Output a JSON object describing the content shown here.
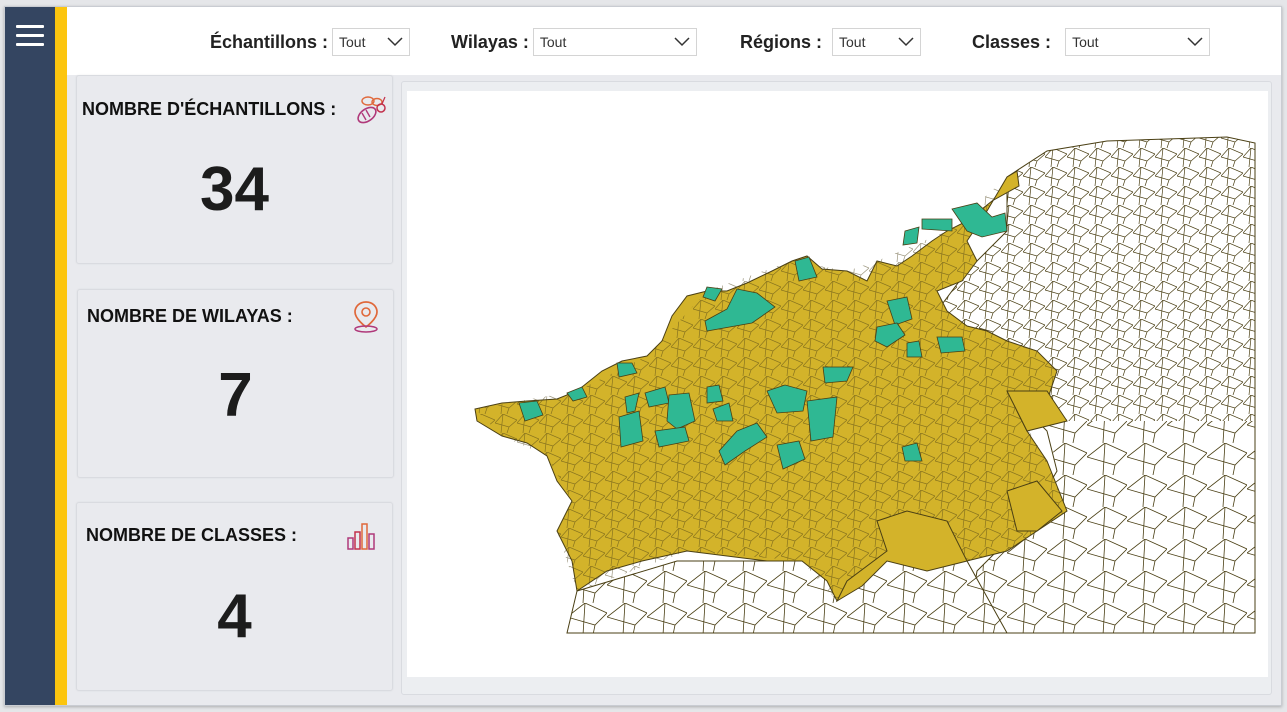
{
  "filters": [
    {
      "label": "Échantillons :",
      "value": "Tout"
    },
    {
      "label": "Wilayas :",
      "value": "Tout"
    },
    {
      "label": "Régions :",
      "value": "Tout"
    },
    {
      "label": "Classes :",
      "value": "Tout"
    }
  ],
  "cards": [
    {
      "title": "NOMBRE D'ÉCHANTILLONS :",
      "value": "34",
      "icon": "bee-icon"
    },
    {
      "title": "NOMBRE DE WILAYAS :",
      "value": "7",
      "icon": "location-pin-icon"
    },
    {
      "title": "NOMBRE DE CLASSES :",
      "value": "4",
      "icon": "bar-chart-icon"
    }
  ],
  "map": {
    "fill_colors": {
      "selected_region": "#d3b32a",
      "sampled": "#2fb893",
      "other": "#ffffff",
      "border": "#4a3f14"
    }
  },
  "colors": {
    "sidebar": "#344561",
    "accent": "#fcc50e",
    "background": "#e9eaee"
  }
}
